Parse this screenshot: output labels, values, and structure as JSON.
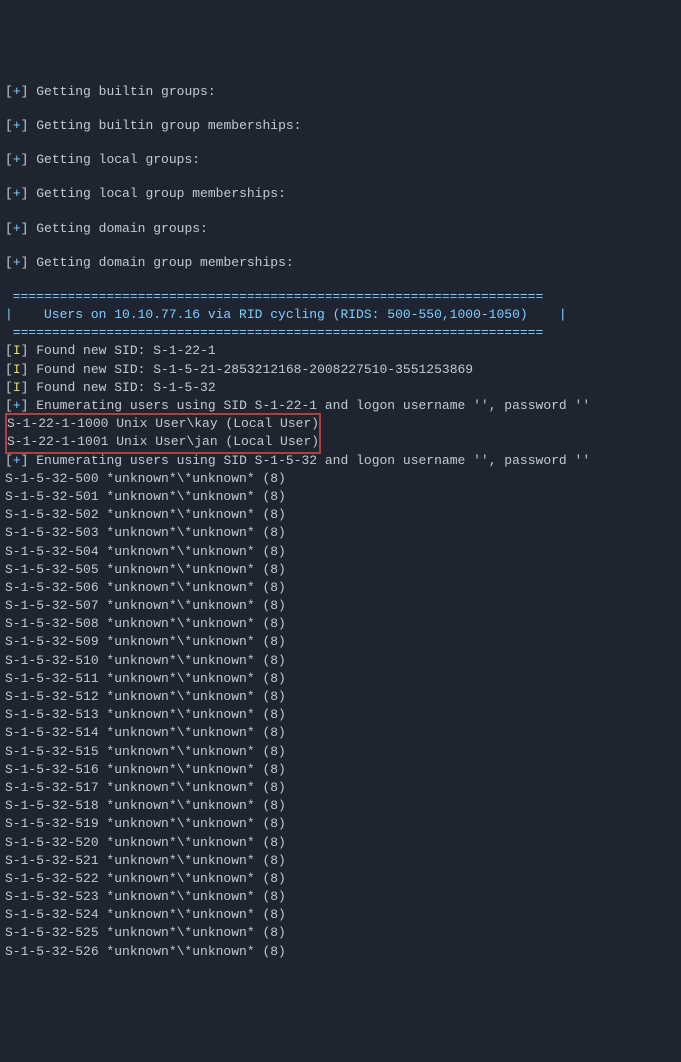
{
  "status_lines": [
    "Getting builtin groups:",
    "Getting builtin group memberships:",
    "Getting local groups:",
    "Getting local group memberships:",
    "Getting domain groups:",
    "Getting domain group memberships:"
  ],
  "divider_line": " ==================================================================== ",
  "section_header_prefix": "|    ",
  "section_header_text": "Users on 10.10.77.16 via RID cycling (RIDS: 500-550,1000-1050)",
  "section_header_suffix": "    |",
  "info_lines": [
    "Found new SID: S-1-22-1",
    "Found new SID: S-1-5-21-2853212168-2008227510-3551253869",
    "Found new SID: S-1-5-32"
  ],
  "enum_line_1": "Enumerating users using SID S-1-22-1 and logon username '', password ''",
  "highlighted_users": [
    "S-1-22-1-1000 Unix User\\kay (Local User)",
    "S-1-22-1-1001 Unix User\\jan (Local User)"
  ],
  "enum_line_2": "Enumerating users using SID S-1-5-32 and logon username '', password ''",
  "unknown_sids": [
    "S-1-5-32-500 *unknown*\\*unknown* (8)",
    "S-1-5-32-501 *unknown*\\*unknown* (8)",
    "S-1-5-32-502 *unknown*\\*unknown* (8)",
    "S-1-5-32-503 *unknown*\\*unknown* (8)",
    "S-1-5-32-504 *unknown*\\*unknown* (8)",
    "S-1-5-32-505 *unknown*\\*unknown* (8)",
    "S-1-5-32-506 *unknown*\\*unknown* (8)",
    "S-1-5-32-507 *unknown*\\*unknown* (8)",
    "S-1-5-32-508 *unknown*\\*unknown* (8)",
    "S-1-5-32-509 *unknown*\\*unknown* (8)",
    "S-1-5-32-510 *unknown*\\*unknown* (8)",
    "S-1-5-32-511 *unknown*\\*unknown* (8)",
    "S-1-5-32-512 *unknown*\\*unknown* (8)",
    "S-1-5-32-513 *unknown*\\*unknown* (8)",
    "S-1-5-32-514 *unknown*\\*unknown* (8)",
    "S-1-5-32-515 *unknown*\\*unknown* (8)",
    "S-1-5-32-516 *unknown*\\*unknown* (8)",
    "S-1-5-32-517 *unknown*\\*unknown* (8)",
    "S-1-5-32-518 *unknown*\\*unknown* (8)",
    "S-1-5-32-519 *unknown*\\*unknown* (8)",
    "S-1-5-32-520 *unknown*\\*unknown* (8)",
    "S-1-5-32-521 *unknown*\\*unknown* (8)",
    "S-1-5-32-522 *unknown*\\*unknown* (8)",
    "S-1-5-32-523 *unknown*\\*unknown* (8)",
    "S-1-5-32-524 *unknown*\\*unknown* (8)",
    "S-1-5-32-525 *unknown*\\*unknown* (8)",
    "S-1-5-32-526 *unknown*\\*unknown* (8)"
  ],
  "prefix_plus": "[+] ",
  "prefix_info": "[I] "
}
